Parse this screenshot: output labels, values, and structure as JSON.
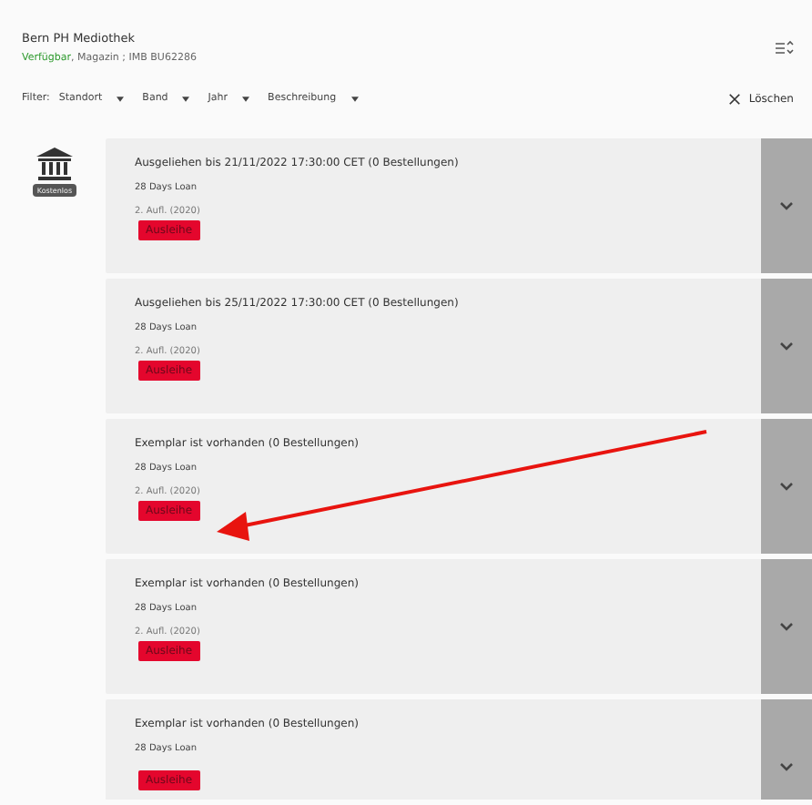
{
  "header": {
    "library": "Bern PH Mediothek",
    "status": "Verfügbar",
    "details": ", Magazin ; IMB BU62286"
  },
  "filter": {
    "label": "Filter:",
    "options": [
      "Standort",
      "Band",
      "Jahr",
      "Beschreibung"
    ],
    "clear": "Löschen"
  },
  "location": {
    "badge": "Kostenlos"
  },
  "items": [
    {
      "title": "Ausgeliehen bis 21/11/2022 17:30:00 CET (0 Bestellungen)",
      "policy": "28 Days Loan",
      "edition": "2. Aufl. (2020)",
      "button": "Ausleihe"
    },
    {
      "title": "Ausgeliehen bis 25/11/2022 17:30:00 CET (0 Bestellungen)",
      "policy": "28 Days Loan",
      "edition": "2. Aufl. (2020)",
      "button": "Ausleihe"
    },
    {
      "title": "Exemplar ist vorhanden (0 Bestellungen)",
      "policy": "28 Days Loan",
      "edition": "2. Aufl. (2020)",
      "button": "Ausleihe"
    },
    {
      "title": "Exemplar ist vorhanden (0 Bestellungen)",
      "policy": "28 Days Loan",
      "edition": "2. Aufl. (2020)",
      "button": "Ausleihe"
    },
    {
      "title": "Exemplar ist vorhanden (0 Bestellungen)",
      "policy": "28 Days Loan",
      "button": "Ausleihe"
    }
  ]
}
